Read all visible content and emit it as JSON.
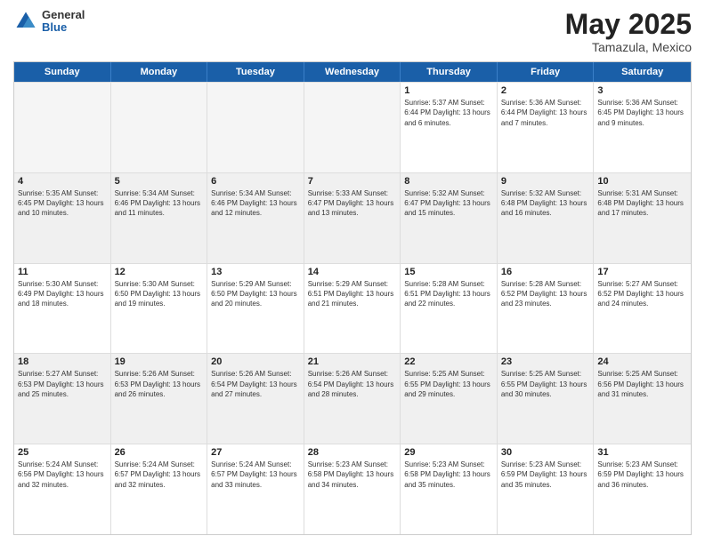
{
  "header": {
    "logo": {
      "general": "General",
      "blue": "Blue"
    },
    "title": "May 2025",
    "location": "Tamazula, Mexico"
  },
  "days_of_week": [
    "Sunday",
    "Monday",
    "Tuesday",
    "Wednesday",
    "Thursday",
    "Friday",
    "Saturday"
  ],
  "weeks": [
    [
      {
        "day": "",
        "content": "",
        "empty": true
      },
      {
        "day": "",
        "content": "",
        "empty": true
      },
      {
        "day": "",
        "content": "",
        "empty": true
      },
      {
        "day": "",
        "content": "",
        "empty": true
      },
      {
        "day": "1",
        "content": "Sunrise: 5:37 AM\nSunset: 6:44 PM\nDaylight: 13 hours\nand 6 minutes.",
        "empty": false
      },
      {
        "day": "2",
        "content": "Sunrise: 5:36 AM\nSunset: 6:44 PM\nDaylight: 13 hours\nand 7 minutes.",
        "empty": false
      },
      {
        "day": "3",
        "content": "Sunrise: 5:36 AM\nSunset: 6:45 PM\nDaylight: 13 hours\nand 9 minutes.",
        "empty": false
      }
    ],
    [
      {
        "day": "4",
        "content": "Sunrise: 5:35 AM\nSunset: 6:45 PM\nDaylight: 13 hours\nand 10 minutes.",
        "empty": false
      },
      {
        "day": "5",
        "content": "Sunrise: 5:34 AM\nSunset: 6:46 PM\nDaylight: 13 hours\nand 11 minutes.",
        "empty": false
      },
      {
        "day": "6",
        "content": "Sunrise: 5:34 AM\nSunset: 6:46 PM\nDaylight: 13 hours\nand 12 minutes.",
        "empty": false
      },
      {
        "day": "7",
        "content": "Sunrise: 5:33 AM\nSunset: 6:47 PM\nDaylight: 13 hours\nand 13 minutes.",
        "empty": false
      },
      {
        "day": "8",
        "content": "Sunrise: 5:32 AM\nSunset: 6:47 PM\nDaylight: 13 hours\nand 15 minutes.",
        "empty": false
      },
      {
        "day": "9",
        "content": "Sunrise: 5:32 AM\nSunset: 6:48 PM\nDaylight: 13 hours\nand 16 minutes.",
        "empty": false
      },
      {
        "day": "10",
        "content": "Sunrise: 5:31 AM\nSunset: 6:48 PM\nDaylight: 13 hours\nand 17 minutes.",
        "empty": false
      }
    ],
    [
      {
        "day": "11",
        "content": "Sunrise: 5:30 AM\nSunset: 6:49 PM\nDaylight: 13 hours\nand 18 minutes.",
        "empty": false
      },
      {
        "day": "12",
        "content": "Sunrise: 5:30 AM\nSunset: 6:50 PM\nDaylight: 13 hours\nand 19 minutes.",
        "empty": false
      },
      {
        "day": "13",
        "content": "Sunrise: 5:29 AM\nSunset: 6:50 PM\nDaylight: 13 hours\nand 20 minutes.",
        "empty": false
      },
      {
        "day": "14",
        "content": "Sunrise: 5:29 AM\nSunset: 6:51 PM\nDaylight: 13 hours\nand 21 minutes.",
        "empty": false
      },
      {
        "day": "15",
        "content": "Sunrise: 5:28 AM\nSunset: 6:51 PM\nDaylight: 13 hours\nand 22 minutes.",
        "empty": false
      },
      {
        "day": "16",
        "content": "Sunrise: 5:28 AM\nSunset: 6:52 PM\nDaylight: 13 hours\nand 23 minutes.",
        "empty": false
      },
      {
        "day": "17",
        "content": "Sunrise: 5:27 AM\nSunset: 6:52 PM\nDaylight: 13 hours\nand 24 minutes.",
        "empty": false
      }
    ],
    [
      {
        "day": "18",
        "content": "Sunrise: 5:27 AM\nSunset: 6:53 PM\nDaylight: 13 hours\nand 25 minutes.",
        "empty": false
      },
      {
        "day": "19",
        "content": "Sunrise: 5:26 AM\nSunset: 6:53 PM\nDaylight: 13 hours\nand 26 minutes.",
        "empty": false
      },
      {
        "day": "20",
        "content": "Sunrise: 5:26 AM\nSunset: 6:54 PM\nDaylight: 13 hours\nand 27 minutes.",
        "empty": false
      },
      {
        "day": "21",
        "content": "Sunrise: 5:26 AM\nSunset: 6:54 PM\nDaylight: 13 hours\nand 28 minutes.",
        "empty": false
      },
      {
        "day": "22",
        "content": "Sunrise: 5:25 AM\nSunset: 6:55 PM\nDaylight: 13 hours\nand 29 minutes.",
        "empty": false
      },
      {
        "day": "23",
        "content": "Sunrise: 5:25 AM\nSunset: 6:55 PM\nDaylight: 13 hours\nand 30 minutes.",
        "empty": false
      },
      {
        "day": "24",
        "content": "Sunrise: 5:25 AM\nSunset: 6:56 PM\nDaylight: 13 hours\nand 31 minutes.",
        "empty": false
      }
    ],
    [
      {
        "day": "25",
        "content": "Sunrise: 5:24 AM\nSunset: 6:56 PM\nDaylight: 13 hours\nand 32 minutes.",
        "empty": false
      },
      {
        "day": "26",
        "content": "Sunrise: 5:24 AM\nSunset: 6:57 PM\nDaylight: 13 hours\nand 32 minutes.",
        "empty": false
      },
      {
        "day": "27",
        "content": "Sunrise: 5:24 AM\nSunset: 6:57 PM\nDaylight: 13 hours\nand 33 minutes.",
        "empty": false
      },
      {
        "day": "28",
        "content": "Sunrise: 5:23 AM\nSunset: 6:58 PM\nDaylight: 13 hours\nand 34 minutes.",
        "empty": false
      },
      {
        "day": "29",
        "content": "Sunrise: 5:23 AM\nSunset: 6:58 PM\nDaylight: 13 hours\nand 35 minutes.",
        "empty": false
      },
      {
        "day": "30",
        "content": "Sunrise: 5:23 AM\nSunset: 6:59 PM\nDaylight: 13 hours\nand 35 minutes.",
        "empty": false
      },
      {
        "day": "31",
        "content": "Sunrise: 5:23 AM\nSunset: 6:59 PM\nDaylight: 13 hours\nand 36 minutes.",
        "empty": false
      }
    ]
  ]
}
